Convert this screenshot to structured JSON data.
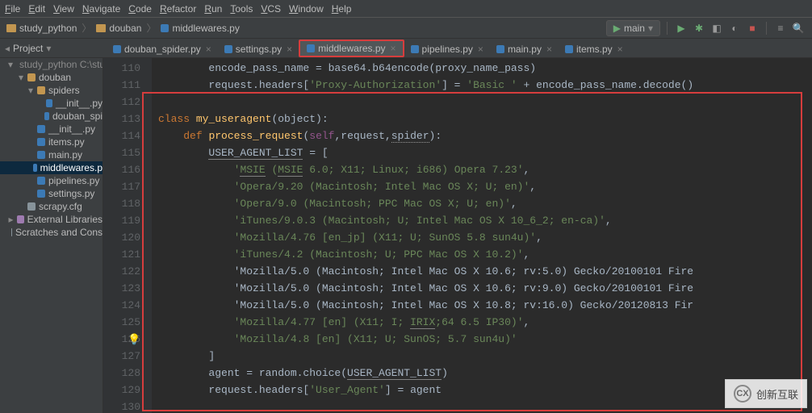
{
  "menubar": [
    "File",
    "Edit",
    "View",
    "Navigate",
    "Code",
    "Refactor",
    "Run",
    "Tools",
    "VCS",
    "Window",
    "Help"
  ],
  "breadcrumb": {
    "project": "study_python",
    "folder": "douban",
    "file": "middlewares.py"
  },
  "run_config": "main",
  "project_panel": {
    "title": "Project"
  },
  "tabs": [
    {
      "label": "douban_spider.py",
      "active": false,
      "highlight": false
    },
    {
      "label": "settings.py",
      "active": false,
      "highlight": false
    },
    {
      "label": "middlewares.py",
      "active": true,
      "highlight": true
    },
    {
      "label": "pipelines.py",
      "active": false,
      "highlight": false
    },
    {
      "label": "main.py",
      "active": false,
      "highlight": false
    },
    {
      "label": "items.py",
      "active": false,
      "highlight": false
    }
  ],
  "tree": [
    {
      "ind": 1,
      "icon": "folder",
      "label": "study_python",
      "caret": "▾",
      "muted": true,
      "tail": " C:\\stu"
    },
    {
      "ind": 2,
      "icon": "folder",
      "label": "douban",
      "caret": "▾"
    },
    {
      "ind": 3,
      "icon": "folder",
      "label": "spiders",
      "caret": "▾"
    },
    {
      "ind": 4,
      "icon": "py",
      "label": "__init__.py"
    },
    {
      "ind": 4,
      "icon": "py",
      "label": "douban_spi"
    },
    {
      "ind": 3,
      "icon": "py",
      "label": "__init__.py"
    },
    {
      "ind": 3,
      "icon": "py",
      "label": "items.py"
    },
    {
      "ind": 3,
      "icon": "py",
      "label": "main.py"
    },
    {
      "ind": 3,
      "icon": "py",
      "label": "middlewares.p",
      "sel": true
    },
    {
      "ind": 3,
      "icon": "py",
      "label": "pipelines.py"
    },
    {
      "ind": 3,
      "icon": "py",
      "label": "settings.py"
    },
    {
      "ind": 2,
      "icon": "cfg",
      "label": "scrapy.cfg"
    },
    {
      "ind": 1,
      "icon": "lib",
      "label": "External Libraries",
      "caret": "▸"
    },
    {
      "ind": 1,
      "icon": "cfg",
      "label": "Scratches and Cons"
    }
  ],
  "line_start": 110,
  "code_lines": [
    "        encode_pass_name = base64.b64encode(proxy_name_pass)",
    "        request.headers['Proxy-Authorization'] = 'Basic ' + encode_pass_name.decode()",
    "",
    "class my_useragent(object):",
    "    def process_request(self,request,spider):",
    "        USER_AGENT_LIST = [",
    "            'MSIE (MSIE 6.0; X11; Linux; i686) Opera 7.23',",
    "            'Opera/9.20 (Macintosh; Intel Mac OS X; U; en)',",
    "            'Opera/9.0 (Macintosh; PPC Mac OS X; U; en)',",
    "            'iTunes/9.0.3 (Macintosh; U; Intel Mac OS X 10_6_2; en-ca)',",
    "            'Mozilla/4.76 [en_jp] (X11; U; SunOS 5.8 sun4u)',",
    "            'iTunes/4.2 (Macintosh; U; PPC Mac OS X 10.2)',",
    "            'Mozilla/5.0 (Macintosh; Intel Mac OS X 10.6; rv:5.0) Gecko/20100101 Fire",
    "            'Mozilla/5.0 (Macintosh; Intel Mac OS X 10.6; rv:9.0) Gecko/20100101 Fire",
    "            'Mozilla/5.0 (Macintosh; Intel Mac OS X 10.8; rv:16.0) Gecko/20120813 Fir",
    "            'Mozilla/4.77 [en] (X11; I; IRIX;64 6.5 IP30)',",
    "            'Mozilla/4.8 [en] (X11; U; SunOS; 5.7 sun4u)'",
    "        ]",
    "        agent = random.choice(USER_AGENT_LIST)",
    "        request.headers['User_Agent'] = agent",
    ""
  ],
  "watermark": {
    "brand": "创新互联",
    "sub": ""
  }
}
